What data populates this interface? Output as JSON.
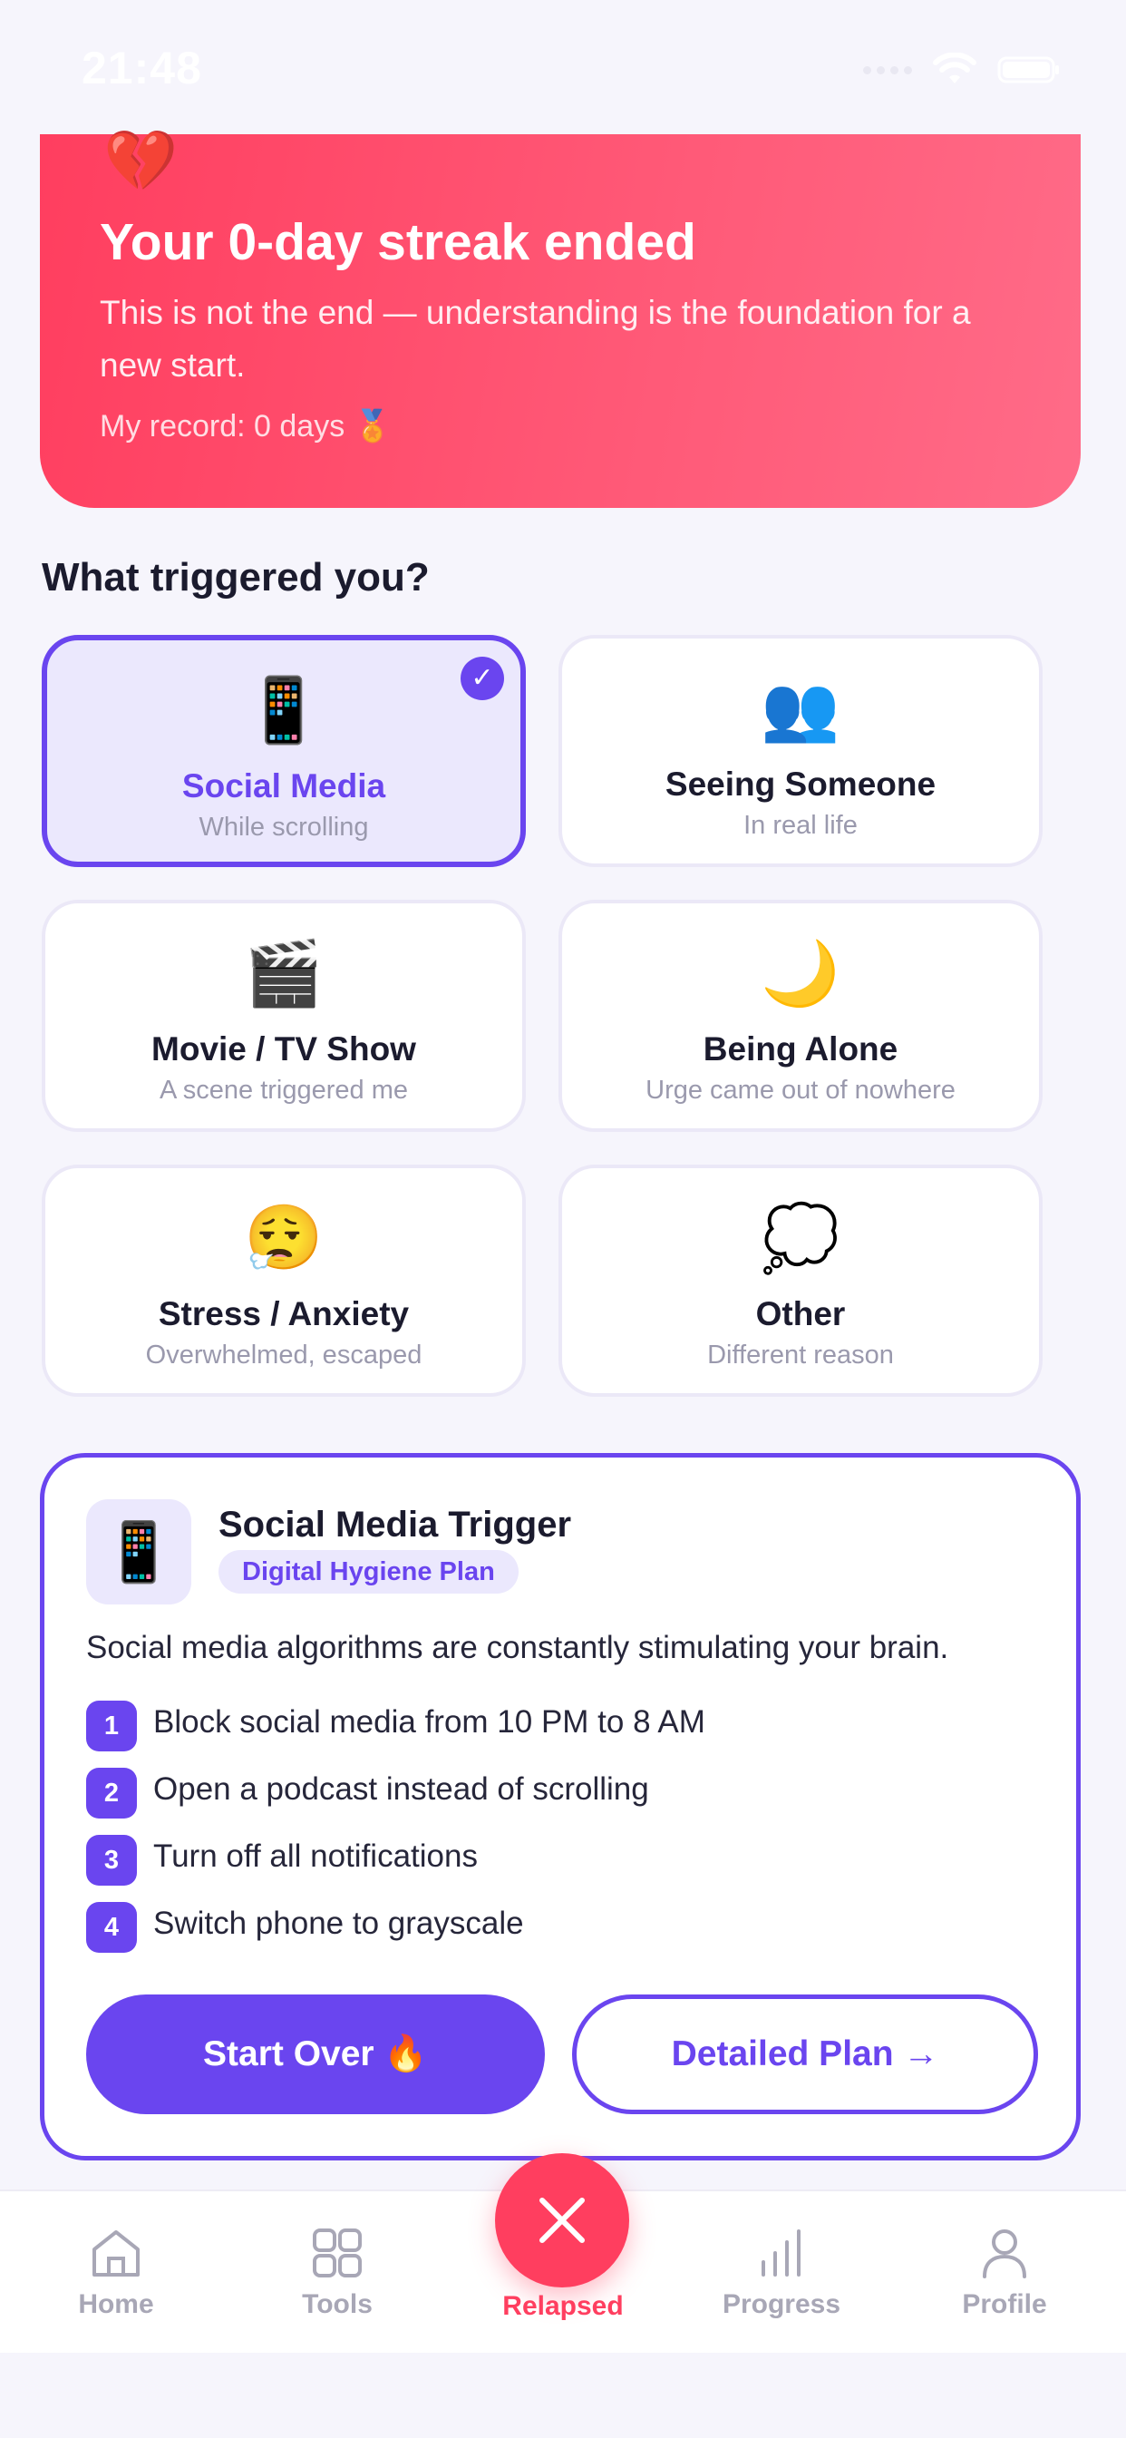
{
  "status_bar": {
    "time": "21:48"
  },
  "hero": {
    "emoji": "💔",
    "title": "Your 0-day streak ended",
    "subtitle": "This is not the end — understanding is the foundation for a new start.",
    "record": "My record: 0 days 🏅"
  },
  "triggers": {
    "title": "What triggered you?",
    "items": [
      {
        "emoji": "📱",
        "title": "Social Media",
        "subtitle": "While scrolling",
        "selected": true
      },
      {
        "emoji": "👥",
        "title": "Seeing Someone",
        "subtitle": "In real life",
        "selected": false
      },
      {
        "emoji": "🎬",
        "title": "Movie / TV Show",
        "subtitle": "A scene triggered me",
        "selected": false
      },
      {
        "emoji": "🌙",
        "title": "Being Alone",
        "subtitle": "Urge came out of nowhere",
        "selected": false
      },
      {
        "emoji": "😮‍💨",
        "title": "Stress / Anxiety",
        "subtitle": "Overwhelmed, escaped",
        "selected": false
      },
      {
        "emoji": "💭",
        "title": "Other",
        "subtitle": "Different reason",
        "selected": false
      }
    ],
    "check_mark": "✓"
  },
  "plan": {
    "icon": "📱",
    "title": "Social Media Trigger",
    "tag": "Digital Hygiene Plan",
    "description": "Social media algorithms are constantly stimulating your brain.",
    "steps": [
      {
        "num": "1",
        "text": "Block social media from 10 PM to 8 AM"
      },
      {
        "num": "2",
        "text": "Open a podcast instead of scrolling"
      },
      {
        "num": "3",
        "text": "Turn off all notifications"
      },
      {
        "num": "4",
        "text": "Switch phone to grayscale"
      }
    ],
    "primary_button": "Start Over 🔥",
    "secondary_button": "Detailed Plan →"
  },
  "tabbar": {
    "home": "Home",
    "tools": "Tools",
    "relapsed": "Relapsed",
    "progress": "Progress",
    "profile": "Profile"
  },
  "colors": {
    "accent": "#6a45ef",
    "danger": "#ff3e5f",
    "background": "#f6f5fc"
  }
}
